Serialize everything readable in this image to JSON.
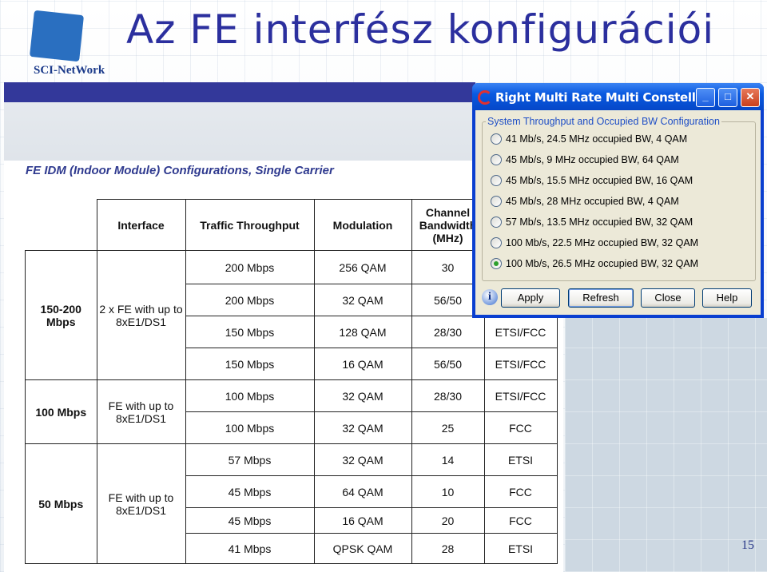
{
  "slide": {
    "title": "Az FE interfész konfigurációi",
    "logo_text": "SCI-NetWork",
    "page_number": "15"
  },
  "document": {
    "subtitle": "FE IDM (Indoor Module) Configurations, Single Carrier",
    "headers": [
      "Interface",
      "Traffic Throughput",
      "Modulation",
      "Channel Bandwidth (MHz)",
      ""
    ],
    "groups": [
      {
        "capacity": "150-200 Mbps",
        "interface": "2 x FE with up to 8xE1/DS1",
        "rows": [
          {
            "throughput": "200 Mbps",
            "modulation": "256 QAM",
            "bandwidth": "30",
            "standard": ""
          },
          {
            "throughput": "200 Mbps",
            "modulation": "32 QAM",
            "bandwidth": "56/50",
            "standard": ""
          },
          {
            "throughput": "150 Mbps",
            "modulation": "128 QAM",
            "bandwidth": "28/30",
            "standard": "ETSI/FCC"
          },
          {
            "throughput": "150 Mbps",
            "modulation": "16 QAM",
            "bandwidth": "56/50",
            "standard": "ETSI/FCC"
          }
        ]
      },
      {
        "capacity": "100 Mbps",
        "interface": "FE with up to 8xE1/DS1",
        "rows": [
          {
            "throughput": "100 Mbps",
            "modulation": "32 QAM",
            "bandwidth": "28/30",
            "standard": "ETSI/FCC"
          },
          {
            "throughput": "100 Mbps",
            "modulation": "32 QAM",
            "bandwidth": "25",
            "standard": "FCC"
          }
        ]
      },
      {
        "capacity": "50 Mbps",
        "interface": "FE with up to 8xE1/DS1",
        "rows": [
          {
            "throughput": "57 Mbps",
            "modulation": "32 QAM",
            "bandwidth": "14",
            "standard": "ETSI"
          },
          {
            "throughput": "45 Mbps",
            "modulation": "64 QAM",
            "bandwidth": "10",
            "standard": "FCC"
          },
          {
            "throughput": "45 Mbps",
            "modulation": "16 QAM",
            "bandwidth": "20",
            "standard": "FCC"
          },
          {
            "throughput": "41 Mbps",
            "modulation": "QPSK QAM",
            "bandwidth": "28",
            "standard": "ETSI"
          }
        ]
      }
    ]
  },
  "dialog": {
    "title": "Right Multi Rate Multi Constell...",
    "window_buttons": {
      "minimize": "_",
      "maximize": "□",
      "close": "✕"
    },
    "group_label": "System Throughput and Occupied BW Configuration",
    "options": [
      {
        "label": "41 Mb/s, 24.5 MHz occupied BW, 4 QAM",
        "selected": false
      },
      {
        "label": "45 Mb/s, 9 MHz occupied BW, 64 QAM",
        "selected": false
      },
      {
        "label": "45 Mb/s, 15.5 MHz occupied BW, 16 QAM",
        "selected": false
      },
      {
        "label": "45 Mb/s, 28 MHz occupied BW, 4 QAM",
        "selected": false
      },
      {
        "label": "57 Mb/s, 13.5 MHz occupied BW, 32 QAM",
        "selected": false
      },
      {
        "label": "100 Mb/s, 22.5 MHz occupied BW, 32 QAM",
        "selected": false
      },
      {
        "label": "100 Mb/s, 26.5 MHz occupied BW, 32 QAM",
        "selected": true
      }
    ],
    "info_icon": "i",
    "buttons": {
      "apply": "Apply",
      "refresh": "Refresh",
      "close": "Close",
      "help": "Help"
    }
  },
  "colors": {
    "title": "#2b2f9e",
    "bar": "#33389a",
    "titlebar": "#0a5ae0",
    "selected_radio": "#2da02d"
  }
}
